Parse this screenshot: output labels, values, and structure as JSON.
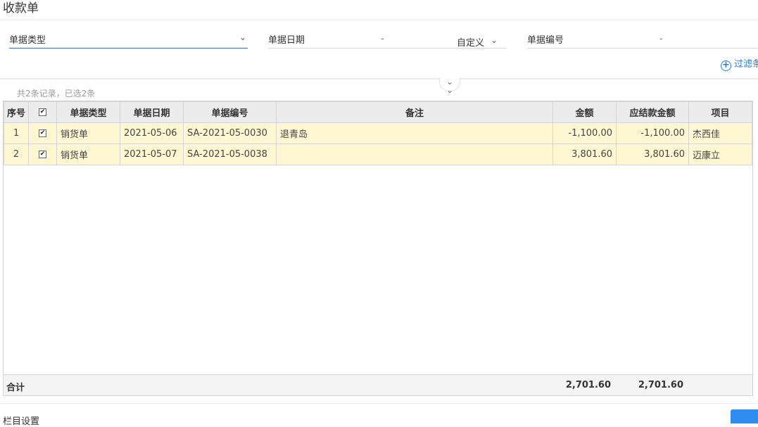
{
  "page": {
    "title": "收款单"
  },
  "filters": {
    "type": {
      "label": "单据类型"
    },
    "date": {
      "label": "单据日期",
      "dash": "-",
      "range_mode": "自定义"
    },
    "number": {
      "label": "单据编号",
      "dash": "-"
    },
    "filter_button": "过滤条"
  },
  "summary": "共2条记录，已选2条",
  "table": {
    "headers": [
      "序号",
      "",
      "单据类型",
      "单据日期",
      "单据编号",
      "备注",
      "金额",
      "应结款金额",
      "项目"
    ],
    "rows": [
      {
        "idx": "1",
        "checked": true,
        "type": "销货单",
        "date": "2021-05-06",
        "number": "SA-2021-05-0030",
        "note": "退青岛",
        "amount": "-1,100.00",
        "due": "-1,100.00",
        "project": "杰西佳"
      },
      {
        "idx": "2",
        "checked": true,
        "type": "销货单",
        "date": "2021-05-07",
        "number": "SA-2021-05-0038",
        "note": "",
        "amount": "3,801.60",
        "due": "3,801.60",
        "project": "迈康立"
      }
    ],
    "totals": {
      "label": "合计",
      "amount": "2,701.60",
      "due": "2,701.60"
    }
  },
  "footer": {
    "label": "栏目设置"
  },
  "colors": {
    "accent": "#2a7ae2",
    "row_highlight": "#fff6d2",
    "negative": "#e00000"
  }
}
